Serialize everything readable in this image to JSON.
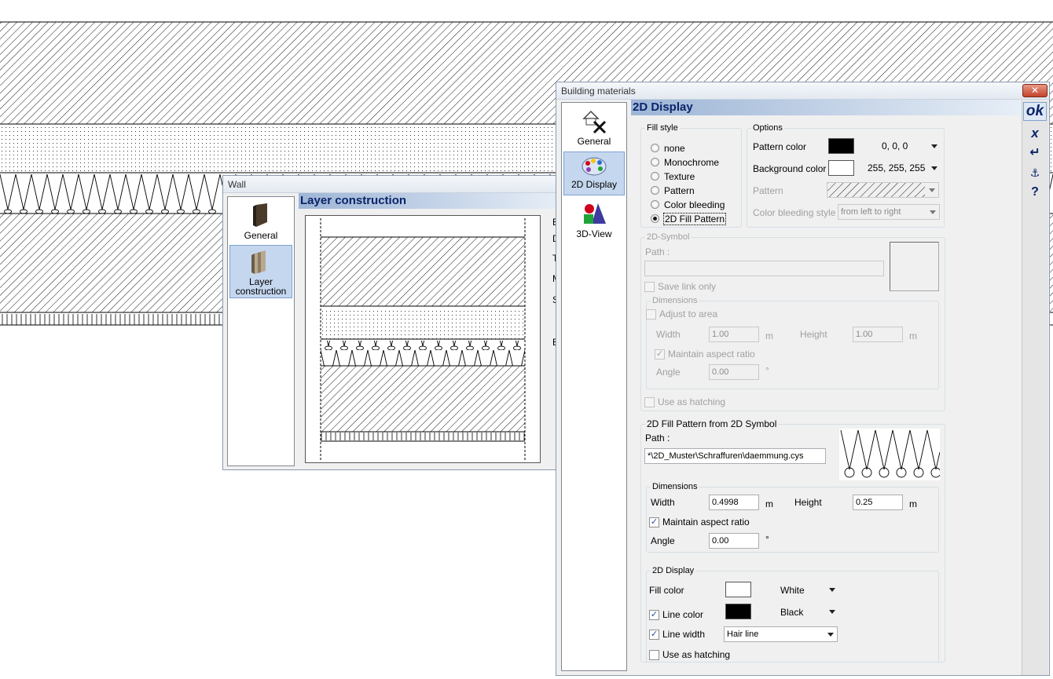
{
  "wall_window": {
    "title": "Wall",
    "nav": [
      {
        "label": "General"
      },
      {
        "label": "Layer construction"
      }
    ],
    "panel_title": "Layer construction",
    "partial_labels": [
      "E",
      "D",
      "T",
      "M",
      "S",
      "E"
    ]
  },
  "materials_window": {
    "title": "Building materials",
    "nav": [
      {
        "label": "General"
      },
      {
        "label": "2D Display"
      },
      {
        "label": "3D-View"
      }
    ],
    "panel_title": "2D Display",
    "actions": {
      "ok": "ok",
      "cancel": "x",
      "enter": "↵",
      "anchor": "⚓",
      "help": "?"
    },
    "close_label": "✕",
    "fill_style": {
      "label": "Fill style",
      "options": [
        "none",
        "Monochrome",
        "Texture",
        "Pattern",
        "Color bleeding",
        "2D Fill Pattern"
      ],
      "selected": "2D Fill Pattern"
    },
    "options": {
      "label": "Options",
      "pattern_color_label": "Pattern color",
      "pattern_color_value": "0, 0, 0",
      "pattern_color_hex": "#000000",
      "background_color_label": "Background color",
      "background_color_value": "255, 255, 255",
      "background_color_hex": "#ffffff",
      "pattern_label": "Pattern",
      "color_bleeding_style_label": "Color bleeding style",
      "color_bleeding_style_value": "from left to right"
    },
    "symbol_2d": {
      "label": "2D-Symbol",
      "path_label": "Path :",
      "save_link_label": "Save link only",
      "dimensions_label": "Dimensions",
      "adjust_label": "Adjust to area",
      "width_label": "Width",
      "width_value": "1.00",
      "width_unit": "m",
      "height_label": "Height",
      "height_value": "1.00",
      "height_unit": "m",
      "maintain_label": "Maintain aspect ratio",
      "angle_label": "Angle",
      "angle_value": "0.00",
      "angle_unit": "°",
      "hatching_label": "Use as hatching"
    },
    "fill_pattern": {
      "label": "2D Fill Pattern from 2D Symbol",
      "path_label": "Path :",
      "path_value": "*\\2D_Muster\\Schraffuren\\daemmung.cys",
      "dimensions_label": "Dimensions",
      "width_label": "Width",
      "width_value": "0.4998",
      "width_unit": "m",
      "height_label": "Height",
      "height_value": "0.25",
      "height_unit": "m",
      "maintain_label": "Maintain aspect ratio",
      "angle_label": "Angle",
      "angle_value": "0.00",
      "angle_unit": "°"
    },
    "display_2d": {
      "label": "2D Display",
      "fill_color_label": "Fill color",
      "fill_color_name": "White",
      "fill_color_hex": "#ffffff",
      "line_color_label": "Line color",
      "line_color_name": "Black",
      "line_color_hex": "#000000",
      "line_width_label": "Line width",
      "line_width_value": "Hair line",
      "hatching_label": "Use as hatching"
    }
  },
  "colors": {
    "nav_active": "#c5d7ef",
    "panel_head_text": "#0a246a",
    "close_button": "#c3432a"
  }
}
